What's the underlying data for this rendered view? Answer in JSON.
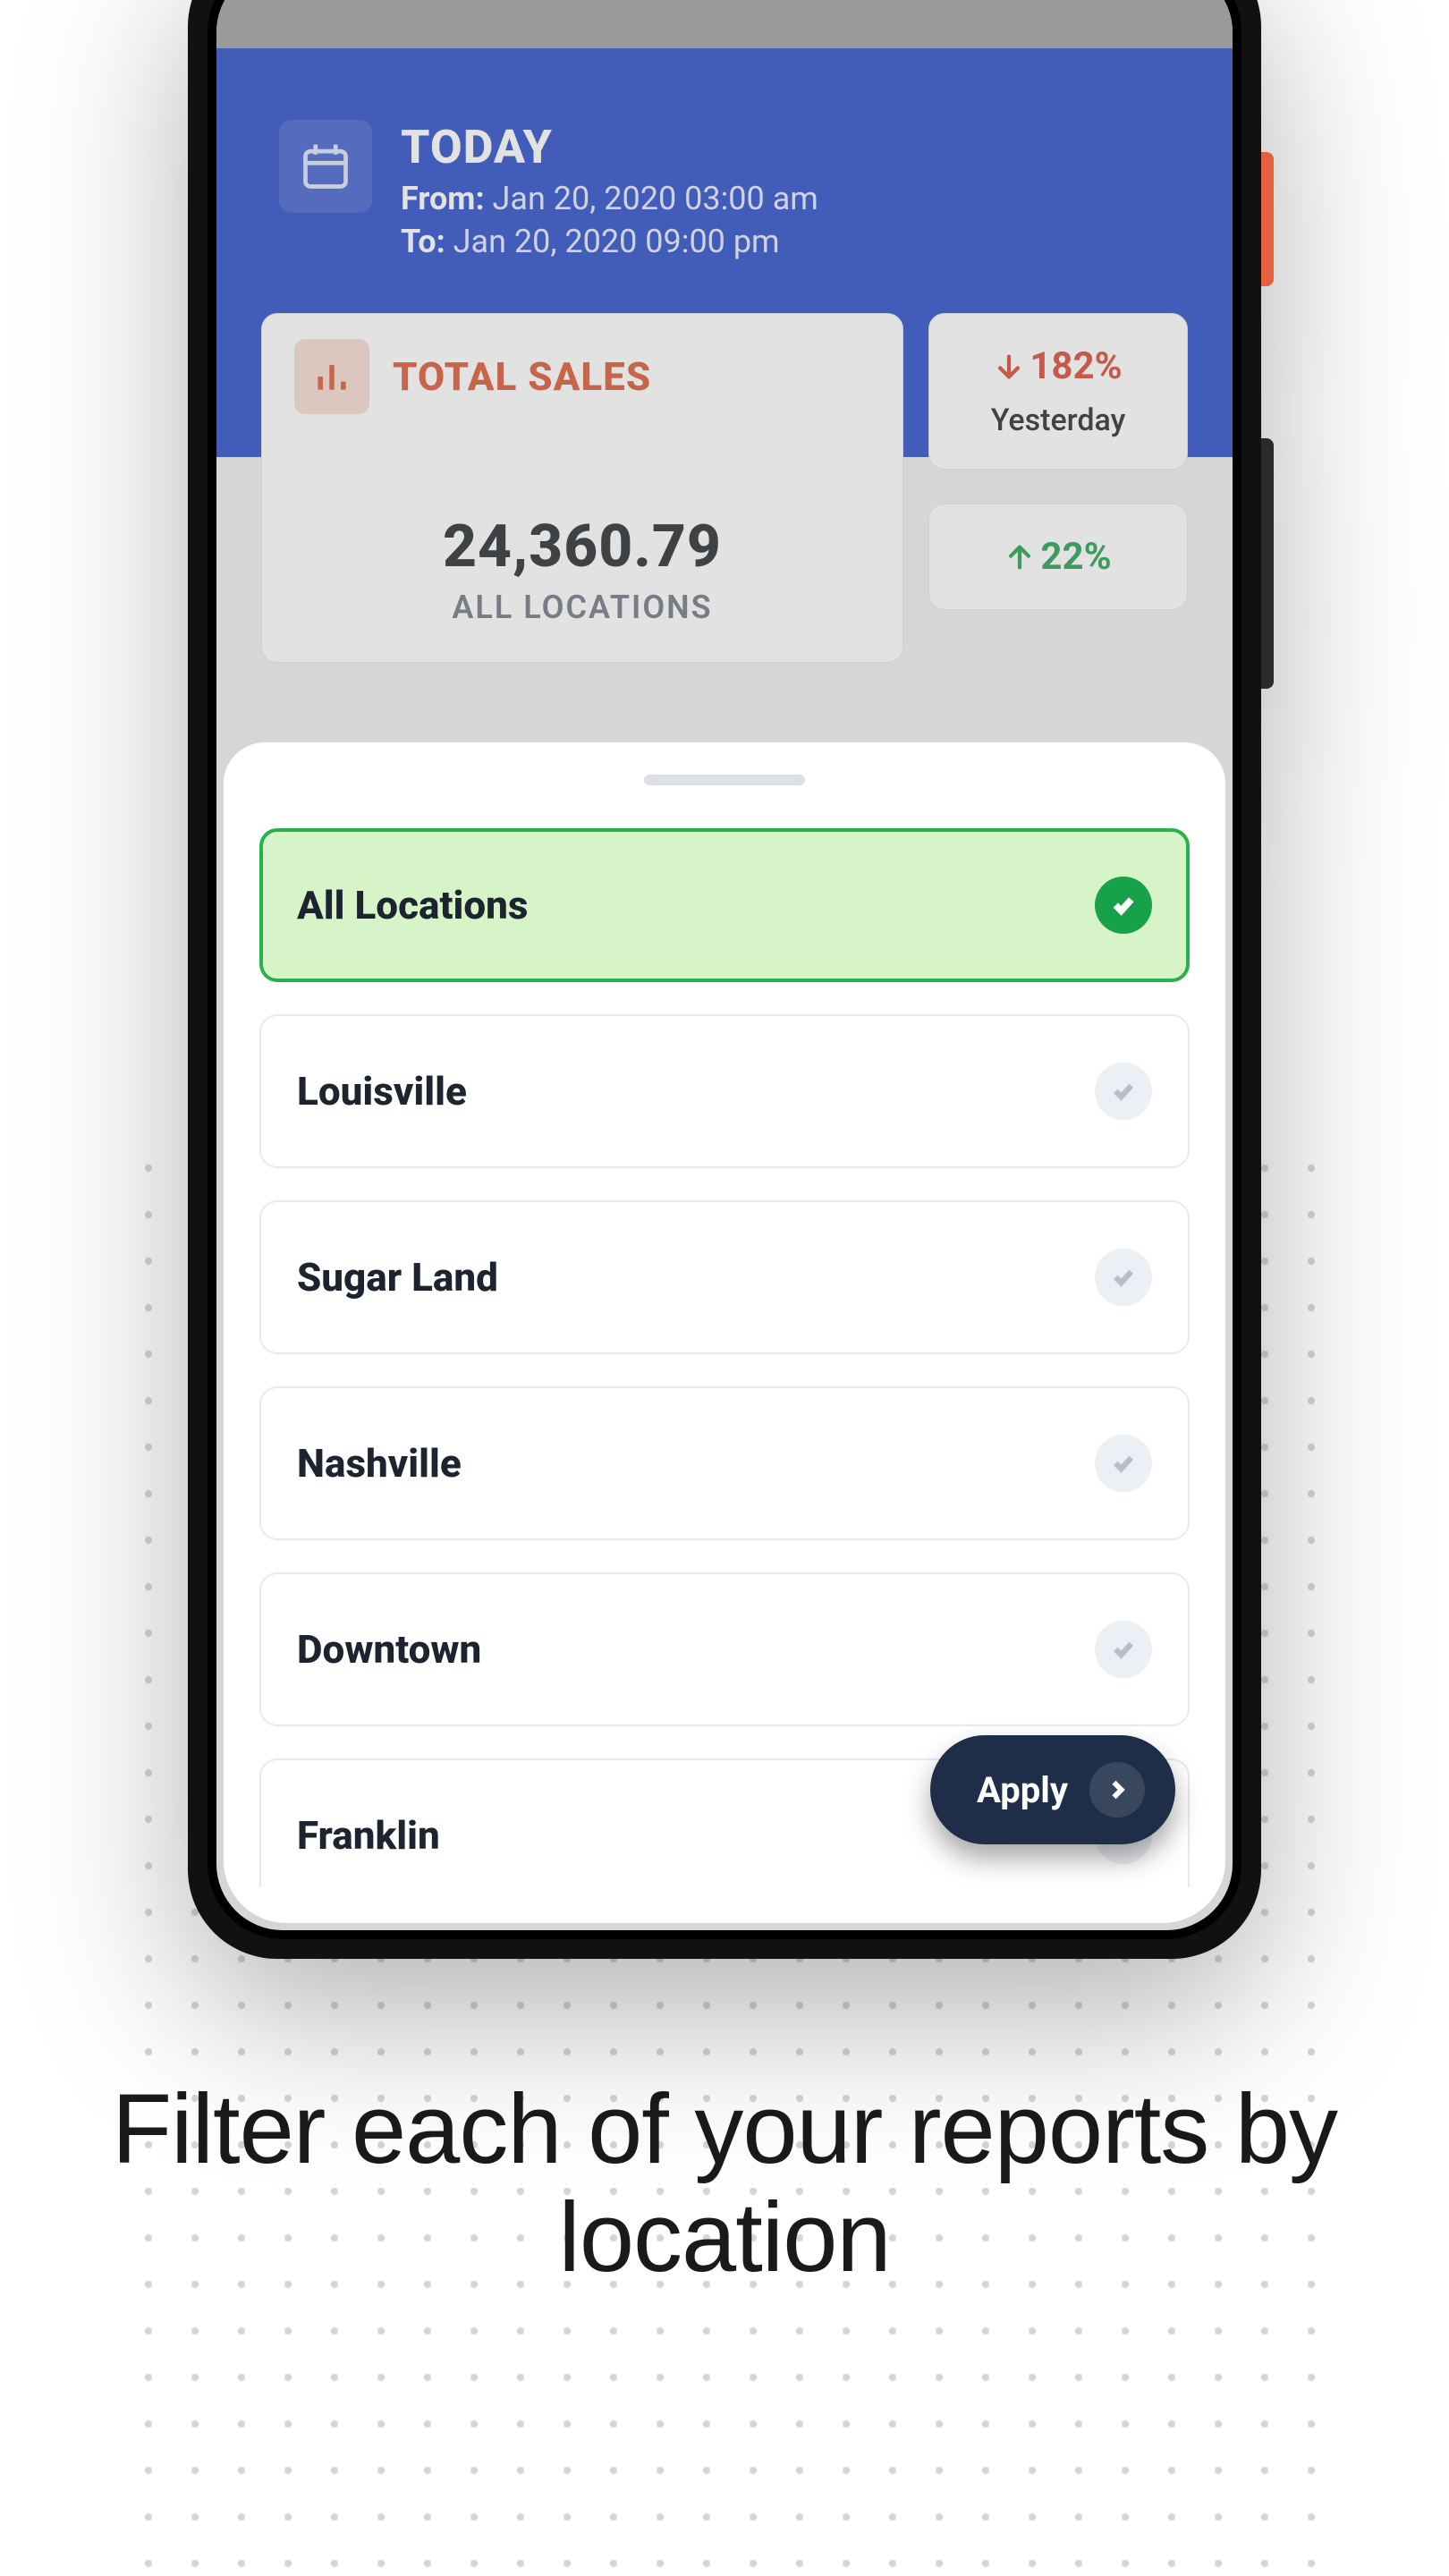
{
  "header": {
    "today_label": "TODAY",
    "from_label": "From:",
    "from_value": "Jan 20, 2020 03:00 am",
    "to_label": "To:",
    "to_value": "Jan 20, 2020 09:00 pm"
  },
  "main_card": {
    "title": "TOTAL SALES",
    "value": "24,360.79",
    "caption": "ALL LOCATIONS"
  },
  "stats": {
    "a_value": "182%",
    "a_sub": "Yesterday",
    "b_value": "22%"
  },
  "sheet": {
    "items": [
      {
        "label": "All Locations",
        "selected": true
      },
      {
        "label": "Louisville",
        "selected": false
      },
      {
        "label": "Sugar Land",
        "selected": false
      },
      {
        "label": "Nashville",
        "selected": false
      },
      {
        "label": "Downtown",
        "selected": false
      },
      {
        "label": "Franklin",
        "selected": false
      }
    ],
    "apply_label": "Apply"
  },
  "headline": "Filter each of your reports by location"
}
